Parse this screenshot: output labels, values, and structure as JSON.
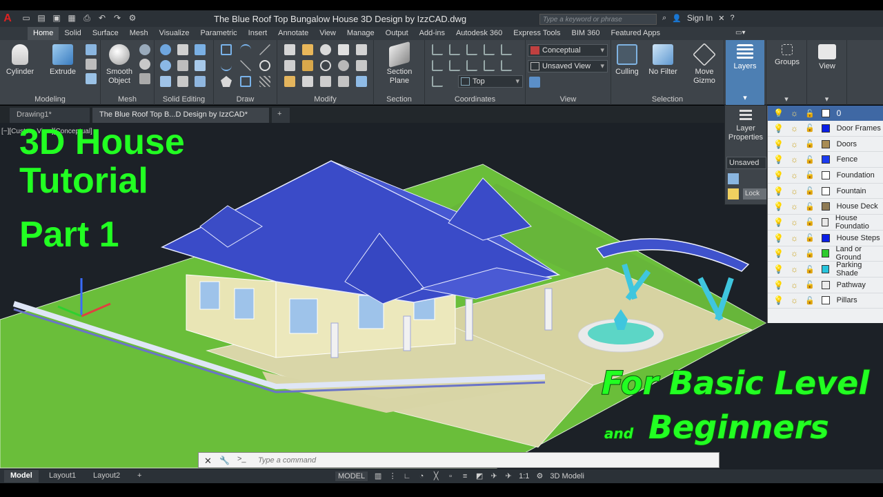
{
  "window": {
    "title": "The Blue Roof Top Bungalow House 3D Design by IzzCAD.dwg",
    "search_placeholder": "Type a keyword or phrase",
    "sign_in": "Sign In"
  },
  "ribbon_tabs": [
    "Home",
    "Solid",
    "Surface",
    "Mesh",
    "Visualize",
    "Parametric",
    "Insert",
    "Annotate",
    "View",
    "Manage",
    "Output",
    "Add-ins",
    "Autodesk 360",
    "Express Tools",
    "BIM 360",
    "Featured Apps"
  ],
  "panels": {
    "modeling": {
      "title": "Modeling",
      "cylinder": "Cylinder",
      "extrude": "Extrude"
    },
    "mesh": {
      "title": "Mesh",
      "smooth_object": "Smooth Object"
    },
    "solid_editing": {
      "title": "Solid Editing"
    },
    "draw": {
      "title": "Draw"
    },
    "modify": {
      "title": "Modify"
    },
    "section": {
      "title": "Section",
      "section_plane": "Section Plane"
    },
    "coordinates": {
      "title": "Coordinates",
      "ucs_value": "Top"
    },
    "view": {
      "title": "View",
      "visual_style": "Conceptual",
      "saved_view": "Unsaved View"
    },
    "selection": {
      "title": "Selection",
      "culling": "Culling",
      "no_filter": "No Filter",
      "move_gizmo": "Move Gizmo"
    },
    "layers": {
      "label": "Layers"
    },
    "groups": {
      "label": "Groups"
    },
    "view_big": {
      "label": "View"
    }
  },
  "layer_flyout": {
    "layer_properties": "Layer Properties",
    "unsaved_state": "Unsaved Li",
    "locked": "Lock"
  },
  "document_tabs": [
    "Drawing1*",
    "The Blue Roof Top B...D Design by IzzCAD*"
  ],
  "viewport_label": "[−][Custom View][Conceptual]",
  "overlay": {
    "title_lines": [
      "3D House",
      "Tutorial",
      "Part 1"
    ],
    "line1": "For Basic Level",
    "and": "and",
    "line2": "Beginners"
  },
  "layers": {
    "current": "0",
    "items": [
      {
        "name": "Door Frames",
        "color": "#0a1ee6"
      },
      {
        "name": "Doors",
        "color": "#a88c55"
      },
      {
        "name": "Fence",
        "color": "#1c3cf0"
      },
      {
        "name": "Foundation",
        "color": "#ffffff"
      },
      {
        "name": "Fountain",
        "color": "#ffffff"
      },
      {
        "name": "House Deck",
        "color": "#8f7b55"
      },
      {
        "name": "House Foundatio",
        "color": "#e8e8e8"
      },
      {
        "name": "House Steps",
        "color": "#0a1ee6"
      },
      {
        "name": "Land or Ground",
        "color": "#2ecb2e"
      },
      {
        "name": "Parking Shade",
        "color": "#27c4dc"
      },
      {
        "name": "Pathway",
        "color": "#ececec"
      },
      {
        "name": "Pillars",
        "color": "#ffffff"
      }
    ]
  },
  "command_line": {
    "placeholder": "Type a command",
    "prompt": ">_"
  },
  "status": {
    "layout_tabs": [
      "Model",
      "Layout1",
      "Layout2"
    ],
    "add_tab": "+",
    "model": "MODEL",
    "scale": "1:1",
    "workspace": "3D Modeli"
  },
  "colors": {
    "roof": "#3a4bc8",
    "ground": "#6abe3a",
    "wall": "#e8e4b8",
    "overlay_text": "#22ff22",
    "ribbon_bg": "#3e444a",
    "viewport_bg": "#1c2127"
  }
}
